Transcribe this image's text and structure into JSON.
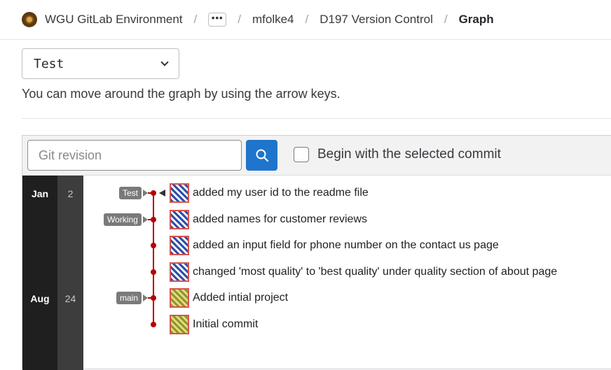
{
  "breadcrumb": {
    "items": [
      "WGU GitLab Environment",
      "mfolke4",
      "D197 Version Control"
    ],
    "ellipsis": "•••",
    "current": "Graph",
    "separator": "/"
  },
  "ref_selector": {
    "value": "Test"
  },
  "hint": "You can move around the graph by using the arrow keys.",
  "toolbar": {
    "search_placeholder": "Git revision",
    "search_value": "",
    "checkbox_label": "Begin with the selected commit",
    "checkbox_checked": false
  },
  "dates": [
    {
      "month": "Jan",
      "day": "2"
    },
    {
      "month": "Aug",
      "day": "24"
    }
  ],
  "commits": [
    {
      "message": "added my user id to the readme file",
      "ref": "Test",
      "avatar": "blue-identicon"
    },
    {
      "message": "added names for customer reviews",
      "ref": "Working",
      "avatar": "blue-identicon"
    },
    {
      "message": "added an input field for phone number on the contact us page",
      "ref": "",
      "avatar": "blue-identicon"
    },
    {
      "message": "changed 'most quality' to 'best quality' under quality section of about page",
      "ref": "",
      "avatar": "blue-identicon"
    },
    {
      "message": "Added intial project",
      "ref": "main",
      "avatar": "green-identicon"
    },
    {
      "message": "Initial commit",
      "ref": "",
      "avatar": "green-identicon"
    }
  ],
  "colors": {
    "accent": "#1f75cb",
    "branch_line": "#b80000",
    "ref_tag": "#7a7a7a"
  }
}
